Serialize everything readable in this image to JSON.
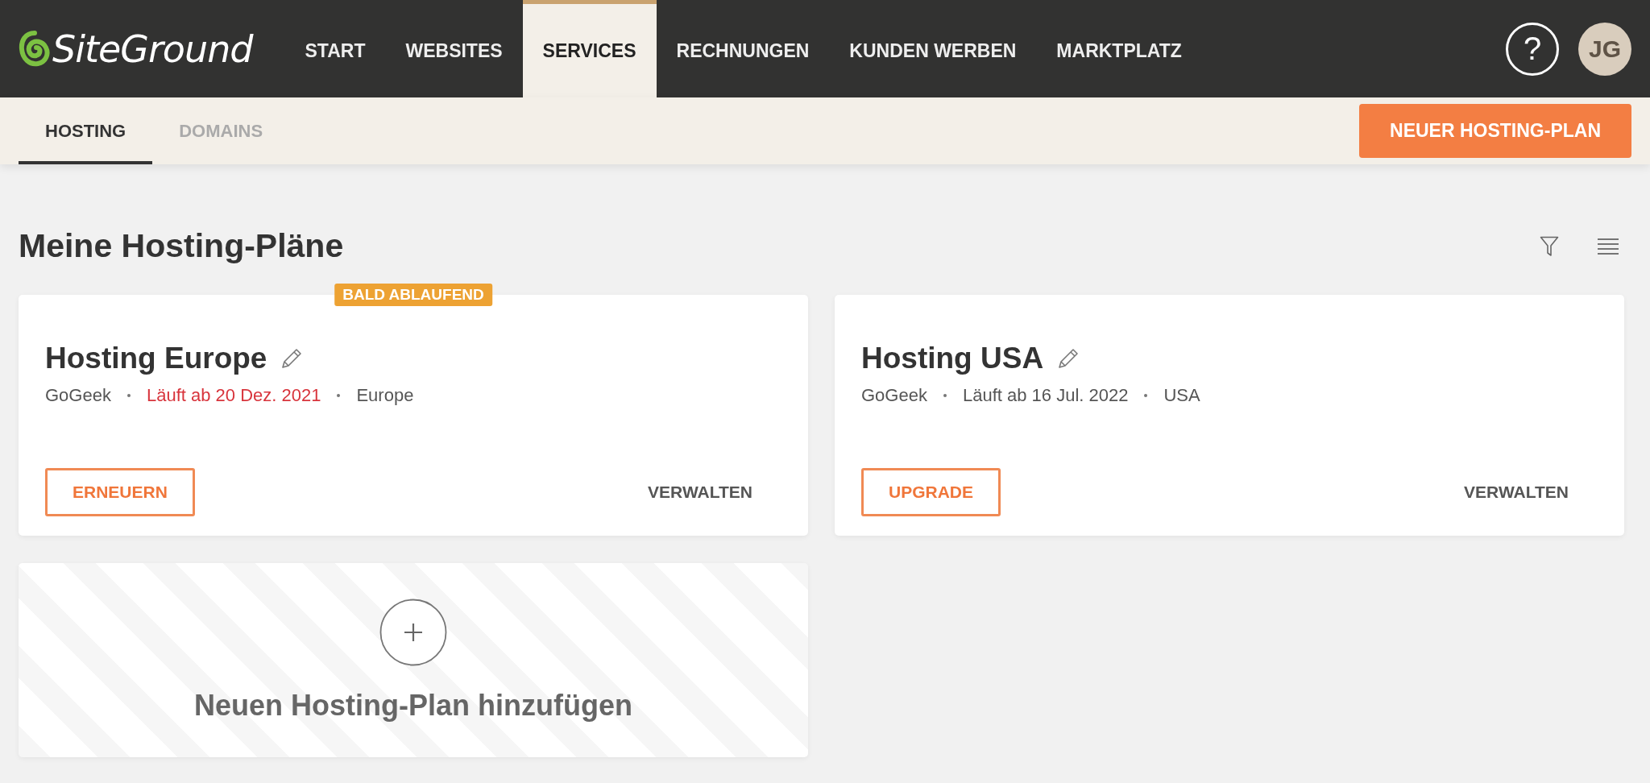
{
  "header": {
    "logo": "SiteGround",
    "nav": [
      {
        "label": "START",
        "selected": false
      },
      {
        "label": "WEBSITES",
        "selected": false
      },
      {
        "label": "SERVICES",
        "selected": true
      },
      {
        "label": "RECHNUNGEN",
        "selected": false
      },
      {
        "label": "KUNDEN WERBEN",
        "selected": false
      },
      {
        "label": "MARKTPLATZ",
        "selected": false
      }
    ],
    "help": "?",
    "avatar": "JG"
  },
  "subnav": {
    "tabs": [
      {
        "label": "HOSTING",
        "selected": true
      },
      {
        "label": "DOMAINS",
        "selected": false
      }
    ],
    "button": "NEUER HOSTING-PLAN"
  },
  "page": {
    "title": "Meine Hosting-Pläne"
  },
  "plans": [
    {
      "badge": "BALD ABLAUFEND",
      "name": "Hosting Europe",
      "plan": "GoGeek",
      "expiry": "Läuft ab 20 Dez. 2021",
      "expiring": true,
      "location": "Europe",
      "action": "ERNEUERN",
      "manage": "VERWALTEN"
    },
    {
      "name": "Hosting USA",
      "plan": "GoGeek",
      "expiry": "Läuft ab 16 Jul. 2022",
      "expiring": false,
      "location": "USA",
      "action": "UPGRADE",
      "manage": "VERWALTEN"
    }
  ],
  "add_card": {
    "label": "Neuen Hosting-Plan hinzufügen"
  }
}
